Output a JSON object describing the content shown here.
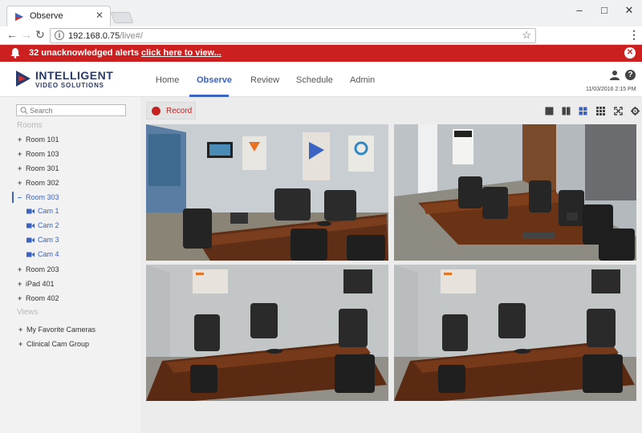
{
  "browser": {
    "tab_title": "Observe",
    "url_host": "192.168.0.75",
    "url_path": "/live#/",
    "window_controls": {
      "minimize": "–",
      "maximize": "□",
      "close": "✕"
    }
  },
  "alert": {
    "count_text": "32 unacknowledged alerts",
    "link_text": "click here to view...",
    "close_label": "✕",
    "color": "#cc1f1f"
  },
  "header": {
    "logo_line1": "INTELLIGENT",
    "logo_line2": "VIDEO SOLUTIONS",
    "nav": [
      "Home",
      "Observe",
      "Review",
      "Schedule",
      "Admin"
    ],
    "active_nav": "Observe",
    "help_label": "?",
    "datetime": "11/03/2016 2:15 PM",
    "accent_color": "#3b63c4"
  },
  "sidebar": {
    "search_placeholder": "Search",
    "rooms_title": "Rooms",
    "rooms": [
      {
        "label": "Room 101",
        "sym": "+"
      },
      {
        "label": "Room 103",
        "sym": "+"
      },
      {
        "label": "Room 301",
        "sym": "+"
      },
      {
        "label": "Room 302",
        "sym": "+"
      },
      {
        "label": "Room 303",
        "sym": "–"
      }
    ],
    "cams": [
      "Cam 1",
      "Cam 2",
      "Cam 3",
      "Cam 4"
    ],
    "rooms_after": [
      {
        "label": "Room 203",
        "sym": "+"
      },
      {
        "label": "iPad 401",
        "sym": "+"
      },
      {
        "label": "Room 402",
        "sym": "+"
      }
    ],
    "views_title": "Views",
    "views": [
      {
        "label": "My Favorite Cameras",
        "sym": "+"
      },
      {
        "label": "Clinical Cam Group",
        "sym": "+"
      }
    ]
  },
  "main": {
    "record_label": "Record",
    "layout_icons": [
      "single-layout-icon",
      "two-column-layout-icon",
      "quad-layout-icon",
      "nine-grid-layout-icon",
      "fullscreen-icon",
      "settings-icon"
    ],
    "cameras": [
      "Cam 1",
      "Cam 2",
      "Cam 3",
      "Cam 4"
    ]
  }
}
